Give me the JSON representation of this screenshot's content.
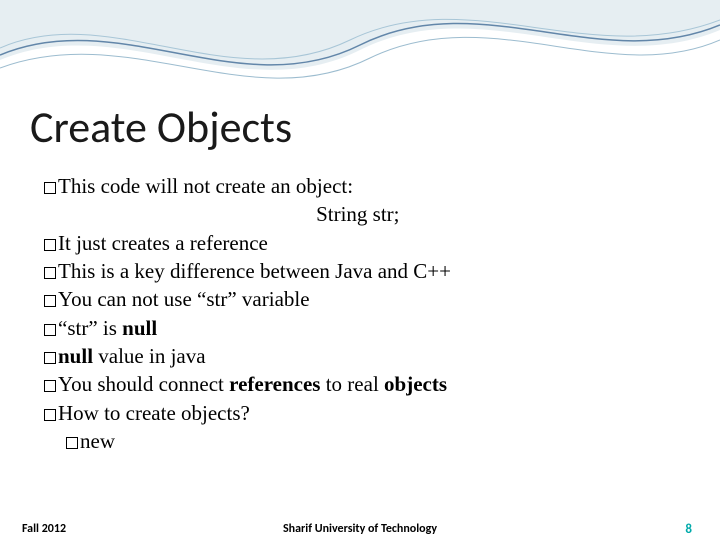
{
  "title": "Create Objects",
  "lines": {
    "l1": "This code will not create an object:",
    "code": "String str;",
    "l2": "It just creates a reference",
    "l3": "This is a key difference between Java and C++",
    "l4": "You can not use “str” variable",
    "l5_pre": "“str” is ",
    "l5_bold": "null",
    "l6_bold": "null",
    "l6_post": " value in java",
    "l7_a": "You should connect ",
    "l7_b": "references",
    "l7_c": " to real ",
    "l7_d": "objects",
    "l8": "How to create objects?",
    "sub1": "new"
  },
  "footer": {
    "left": "Fall 2012",
    "center": "Sharif University of Technology",
    "right": "8"
  }
}
